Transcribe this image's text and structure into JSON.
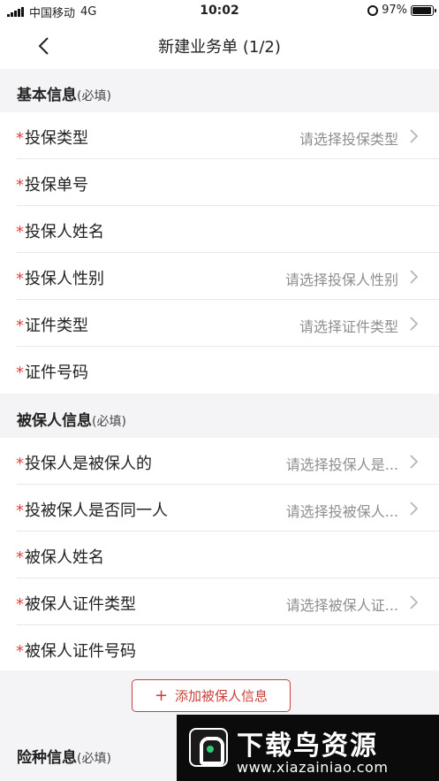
{
  "status_bar": {
    "carrier": "中国移动",
    "network": "4G",
    "time": "10:02",
    "battery": "97%",
    "battery_level": 0.97,
    "icons": [
      "signal-icon",
      "alarm-icon",
      "battery-icon"
    ]
  },
  "nav": {
    "title": "新建业务单 (1/2)",
    "back_icon": "chevron-left-icon"
  },
  "sections": {
    "policyholder": {
      "title": "基本信息",
      "required": "(必填)",
      "rows": [
        {
          "star": "*",
          "label": "投保类型",
          "value": "请选择投保类型"
        },
        {
          "star": "*",
          "label": "投保单号",
          "value": ""
        },
        {
          "star": "*",
          "label": "投保人姓名",
          "value": ""
        },
        {
          "star": "*",
          "label": "投保人性别",
          "value": "请选择投保人性别"
        },
        {
          "star": "*",
          "label": "证件类型",
          "value": "请选择证件类型"
        },
        {
          "star": "*",
          "label": "证件号码",
          "value": ""
        }
      ]
    },
    "insured": {
      "title": "被保人信息",
      "required": "(必填)",
      "rows": [
        {
          "star": "*",
          "label": "投保人是被保人的",
          "value": "请选择投保人是..."
        },
        {
          "star": "*",
          "label": "投被保人是否同一人",
          "value": "请选择投被保人..."
        },
        {
          "star": "*",
          "label": "被保人姓名",
          "value": ""
        },
        {
          "star": "*",
          "label": "被保人证件类型",
          "value": "请选择被保人证..."
        },
        {
          "star": "*",
          "label": "被保人证件号码",
          "value": ""
        }
      ],
      "add_button": "添加被保人信息"
    },
    "insurance": {
      "title": "险种信息",
      "required": "(必填)"
    }
  },
  "watermark": {
    "text": "下载鸟资源",
    "url": "www.xiazainiao.com"
  },
  "colors": {
    "accent": "#c9403a",
    "required_star": "#e0433b",
    "placeholder": "#8e8e93",
    "background": "#f4f4f6"
  }
}
